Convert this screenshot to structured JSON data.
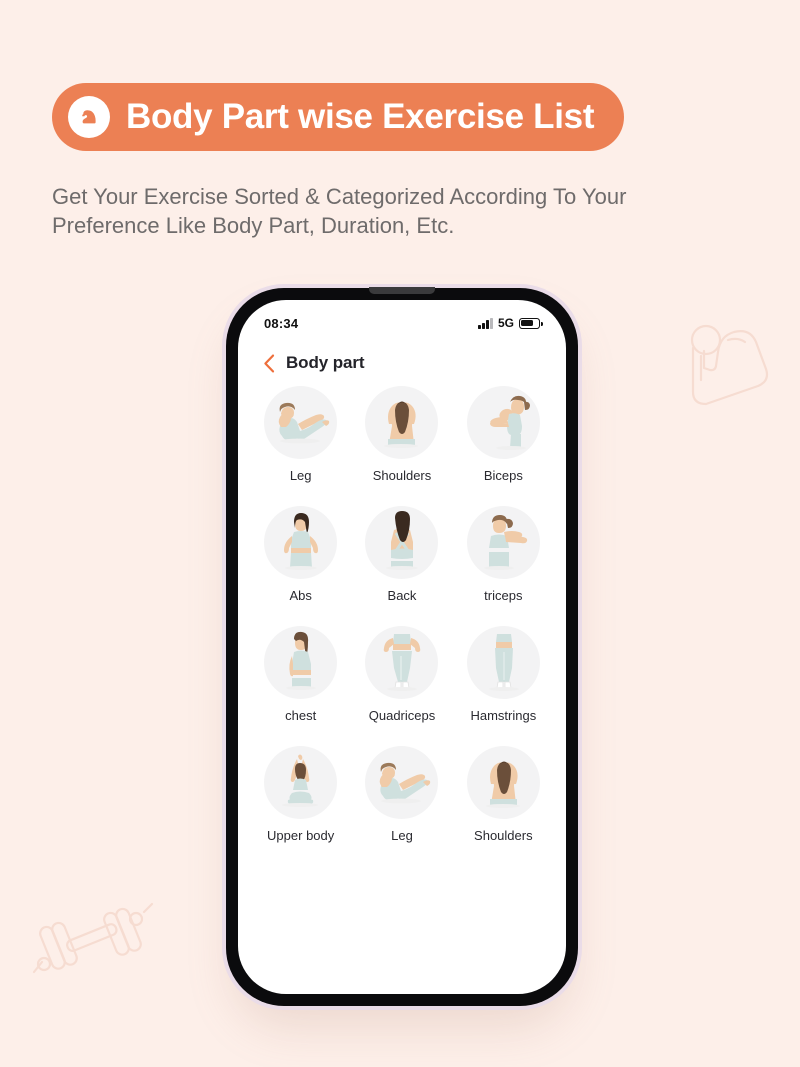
{
  "theme": {
    "background": "#FDEFE9",
    "accent": "#EC8054",
    "pill_text": "#FFFFFF",
    "subtitle_color": "#6E6B6B",
    "thumb_background": "#F3F3F4",
    "phone_bezel": "#0B0B0D",
    "phone_edge": "#EADCE8",
    "figure_outfit": "#CFE0DE",
    "figure_skin": "#F0CBA8"
  },
  "header": {
    "icon": "flexed-bicep-icon",
    "title": "Body Part wise Exercise List",
    "subtitle": "Get Your Exercise Sorted & Categorized According To Your Preference Like Body Part, Duration, Etc."
  },
  "decorations": [
    {
      "name": "flexed-bicep-outline",
      "position": "top-right"
    },
    {
      "name": "dumbbell-outline",
      "position": "bottom-left"
    }
  ],
  "phone": {
    "status_bar": {
      "time": "08:34",
      "signal_icon": "signal-bars-icon",
      "network": "5G",
      "battery_icon": "battery-icon",
      "battery_level": 60
    },
    "nav": {
      "back_icon": "chevron-left-icon",
      "title": "Body part"
    },
    "grid": {
      "items": [
        {
          "label": "Leg",
          "pose": "boat-pose"
        },
        {
          "label": "Shoulders",
          "pose": "arms-overhead-back"
        },
        {
          "label": "Biceps",
          "pose": "arm-curl-side"
        },
        {
          "label": "Abs",
          "pose": "hands-on-hips-front"
        },
        {
          "label": "Back",
          "pose": "back-view-standing"
        },
        {
          "label": "triceps",
          "pose": "arm-across-chest"
        },
        {
          "label": "chest",
          "pose": "three-quarter-standing"
        },
        {
          "label": "Quadriceps",
          "pose": "legs-front-standing"
        },
        {
          "label": "Hamstrings",
          "pose": "legs-back-standing"
        },
        {
          "label": "Upper body",
          "pose": "seated-arms-up"
        },
        {
          "label": "Leg",
          "pose": "boat-pose"
        },
        {
          "label": "Shoulders",
          "pose": "arms-overhead-back"
        }
      ]
    }
  }
}
